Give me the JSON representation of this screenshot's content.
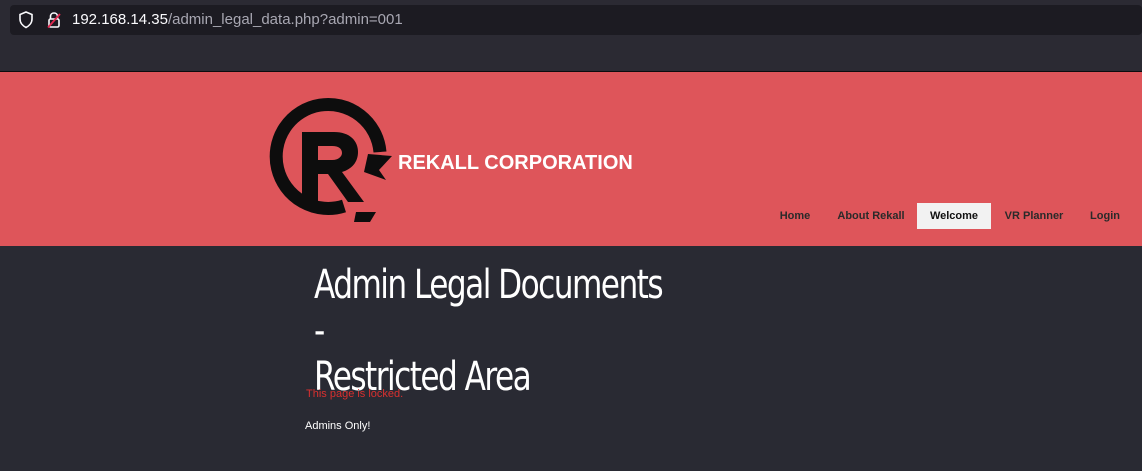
{
  "browser": {
    "url_host": "192.168.14.35",
    "url_path": "/admin_legal_data.php?admin=001"
  },
  "header": {
    "brand": "REKALL CORPORATION",
    "logo_icon": "rekall-r-logo-icon",
    "background_color": "#de555a"
  },
  "nav": {
    "items": [
      {
        "label": "Home",
        "active": false
      },
      {
        "label": "About Rekall",
        "active": false
      },
      {
        "label": "Welcome",
        "active": true
      },
      {
        "label": "VR Planner",
        "active": false
      },
      {
        "label": "Login",
        "active": false
      }
    ]
  },
  "main": {
    "title_line1": "Admin Legal Documents -",
    "title_line2": "Restricted Area",
    "locked_message": "This page is locked.",
    "locked_color": "#d9302f",
    "admins_message": "Admins Only!"
  }
}
